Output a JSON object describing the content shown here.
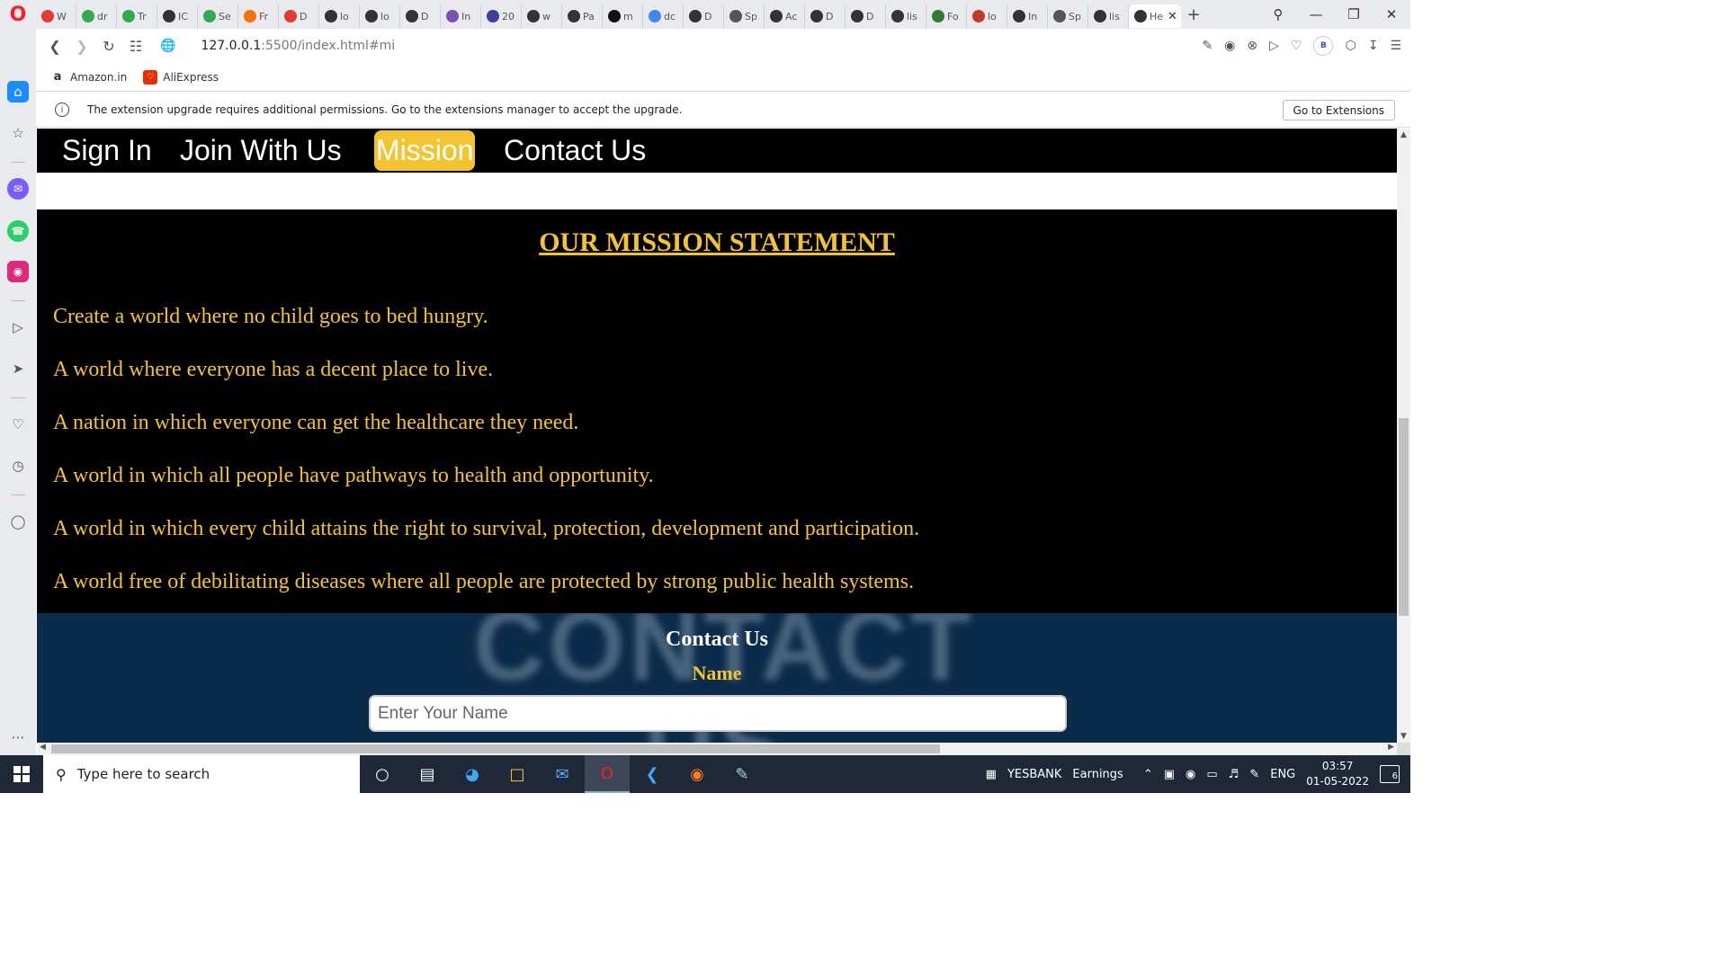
{
  "browser": {
    "tabs": [
      {
        "label": "W",
        "icon": "opera-error-icon",
        "color": "#e53935"
      },
      {
        "label": "dr",
        "icon": "google-drive-icon",
        "color": "#34a853"
      },
      {
        "label": "Tr",
        "icon": "google-drive-icon",
        "color": "#34a853"
      },
      {
        "label": "IC",
        "icon": "github-icon",
        "color": "#333333"
      },
      {
        "label": "Se",
        "icon": "google-drive-icon",
        "color": "#34a853"
      },
      {
        "label": "Fr",
        "icon": "freelancer-icon",
        "color": "#ff6f00"
      },
      {
        "label": "D",
        "icon": "heart-icon",
        "color": "#e53935"
      },
      {
        "label": "lo",
        "icon": "github-icon",
        "color": "#333333"
      },
      {
        "label": "lo",
        "icon": "github-icon",
        "color": "#333333"
      },
      {
        "label": "D",
        "icon": "github-icon",
        "color": "#333333"
      },
      {
        "label": "In",
        "icon": "bootstrap-icon",
        "color": "#7952b3"
      },
      {
        "label": "20",
        "icon": "stack-icon",
        "color": "#3f3f9f"
      },
      {
        "label": "w",
        "icon": "github-icon",
        "color": "#333333"
      },
      {
        "label": "Pa",
        "icon": "github-icon",
        "color": "#333333"
      },
      {
        "label": "m",
        "icon": "github-icon",
        "color": "#111111"
      },
      {
        "label": "dc",
        "icon": "google-icon",
        "color": "#4285f4"
      },
      {
        "label": "D",
        "icon": "github-icon",
        "color": "#333333"
      },
      {
        "label": "Sp",
        "icon": "grid-icon",
        "color": "#555555"
      },
      {
        "label": "Ac",
        "icon": "github-icon",
        "color": "#333333"
      },
      {
        "label": "D",
        "icon": "github-icon",
        "color": "#333333"
      },
      {
        "label": "D",
        "icon": "github-icon",
        "color": "#333333"
      },
      {
        "label": "lis",
        "icon": "github-icon",
        "color": "#333333"
      },
      {
        "label": "Fo",
        "icon": "infinity-icon",
        "color": "#2e7d32"
      },
      {
        "label": "lo",
        "icon": "pixel-icon",
        "color": "#c0392b"
      },
      {
        "label": "In",
        "icon": "github-icon",
        "color": "#333333"
      },
      {
        "label": "Sp",
        "icon": "grid-icon",
        "color": "#555555"
      },
      {
        "label": "lis",
        "icon": "github-icon",
        "color": "#333333"
      }
    ],
    "active_tab": {
      "label": "He",
      "close": "✕"
    },
    "new_tab": "+",
    "url_host": "127.0.0.1",
    "url_path": ":5500/index.html#mi",
    "bookmarks": [
      {
        "label": "Amazon.in",
        "icon": "amazon-icon"
      },
      {
        "label": "AliExpress",
        "icon": "aliexpress-icon"
      }
    ],
    "profile_initial": "B",
    "infobar_text": "The extension upgrade requires additional permissions. Go to the extensions manager to accept the upgrade.",
    "infobar_button": "Go to Extensions"
  },
  "site": {
    "nav": [
      {
        "label": "Sign In",
        "active": false
      },
      {
        "label": "Join With Us",
        "active": false
      },
      {
        "label": "Mission",
        "active": true
      },
      {
        "label": "Contact Us",
        "active": false
      }
    ],
    "mission_title": "OUR MISSION STATEMENT",
    "mission_lines": [
      "Create a world where no child goes to bed hungry.",
      "A world where everyone has a decent place to live.",
      "A nation in which everyone can get the healthcare they need.",
      "A world in which all people have pathways to health and opportunity.",
      "A world in which every child attains the right to survival, protection, development and participation.",
      "A world free of debilitating diseases where all people are protected by strong public health systems."
    ],
    "contact_bg_text": "CONTACT US",
    "contact_title": "Contact Us",
    "name_label": "Name",
    "name_placeholder": "Enter Your Name",
    "accent_color": "#f4c430"
  },
  "taskbar": {
    "search_placeholder": "Type here to search",
    "ticker_symbol": "YESBANK",
    "ticker_label": "Earnings",
    "language": "ENG",
    "time": "03:57",
    "date": "01-05-2022",
    "notification_count": "6"
  }
}
